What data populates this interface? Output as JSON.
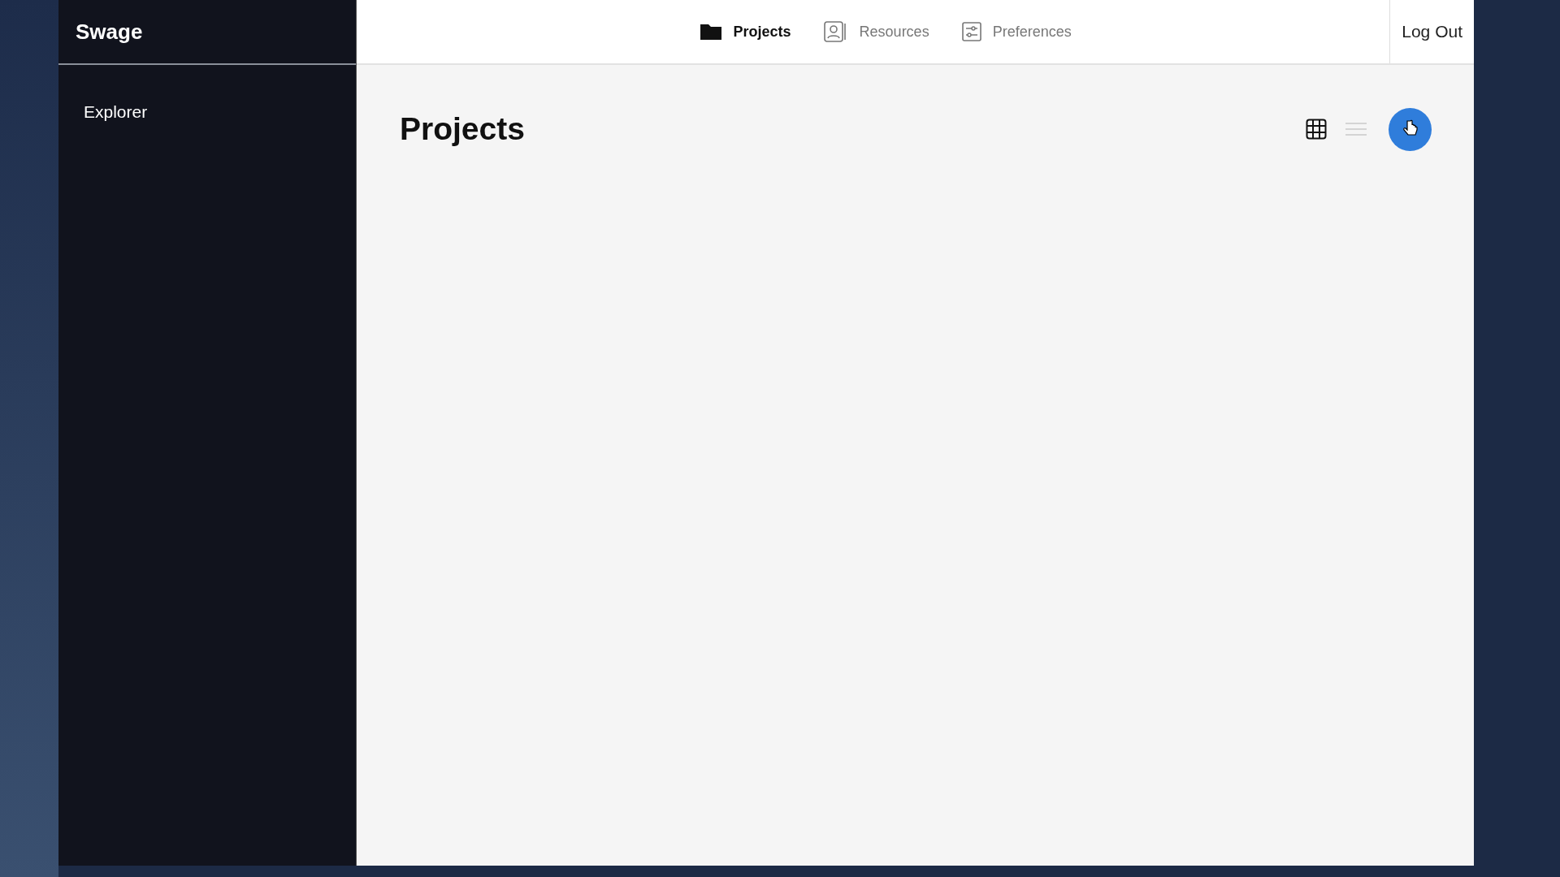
{
  "app": {
    "name": "Swage"
  },
  "sidebar": {
    "items": [
      {
        "label": "Explorer"
      }
    ]
  },
  "nav": {
    "tabs": [
      {
        "label": "Projects",
        "kind": "folder",
        "selected": true
      },
      {
        "label": "Resources",
        "kind": "contact",
        "selected": false
      },
      {
        "label": "Preferences",
        "kind": "sliders",
        "selected": false
      }
    ],
    "logout": "Log Out"
  },
  "page": {
    "title": "Projects",
    "views": [
      {
        "kind": "grid",
        "selected": true
      },
      {
        "kind": "list",
        "selected": false
      }
    ]
  }
}
